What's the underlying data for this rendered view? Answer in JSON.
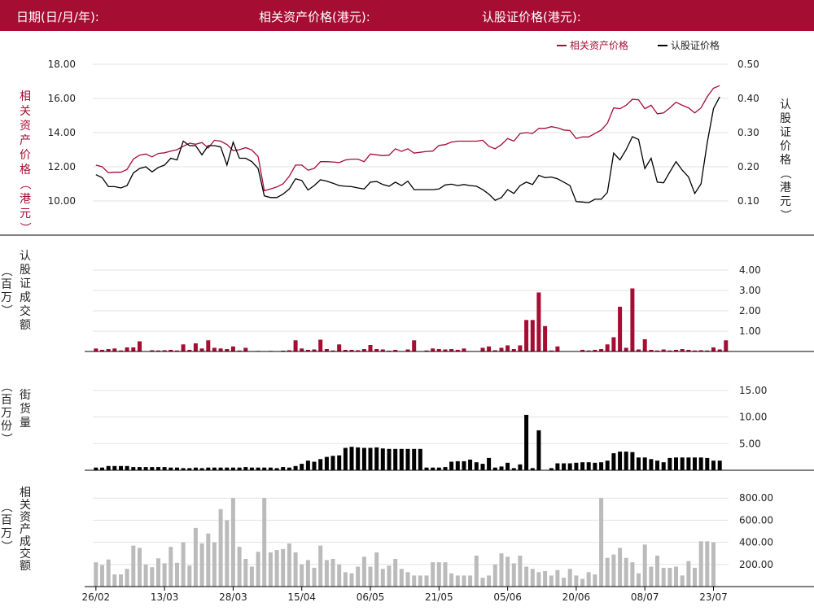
{
  "header": {
    "date_label": "日期(日/月/年):",
    "date_value": "",
    "asset_price_label": "相关资产价格(港元):",
    "asset_price_value": "",
    "warrant_price_label": "认股证价格(港元):",
    "warrant_price_value": ""
  },
  "colors": {
    "header_bg": "#a50d33",
    "asset": "#a50d33",
    "warrant": "#000000",
    "asset_turnover_bars": "#bbbbbb"
  },
  "legend": {
    "asset": "相关资产价格",
    "warrant": "认股证价格"
  },
  "x_tick_labels": [
    "26/02",
    "13/03",
    "28/03",
    "15/04",
    "06/05",
    "21/05",
    "05/06",
    "20/06",
    "08/07",
    "23/07"
  ],
  "chart_data": [
    {
      "type": "line",
      "title": "",
      "left_axis_label": "相关资产价格（港元）",
      "right_axis_label": "认股证价格（港元）",
      "left_ticks": [
        "10.00",
        "12.00",
        "14.00",
        "16.00",
        "18.00"
      ],
      "right_ticks": [
        "0.10",
        "0.20",
        "0.30",
        "0.40",
        "0.50"
      ],
      "ylim_left": [
        10,
        18
      ],
      "ylim_right": [
        0.1,
        0.5
      ],
      "x_count": 101,
      "grid": true,
      "legend_position": "top-right",
      "series": [
        {
          "name": "相关资产价格",
          "axis": "left",
          "values": [
            12.1,
            12.0,
            11.65,
            11.68,
            11.68,
            11.85,
            12.45,
            12.68,
            12.75,
            12.58,
            12.78,
            12.82,
            12.92,
            13.0,
            13.2,
            13.38,
            13.32,
            13.42,
            13.1,
            13.55,
            13.5,
            13.3,
            12.95,
            13.0,
            13.12,
            12.98,
            12.6,
            10.6,
            10.7,
            10.82,
            11.0,
            11.45,
            12.1,
            12.1,
            11.8,
            11.9,
            12.3,
            12.3,
            12.28,
            12.25,
            12.4,
            12.45,
            12.45,
            12.3,
            12.75,
            12.7,
            12.65,
            12.68,
            13.05,
            12.9,
            13.05,
            12.8,
            12.85,
            12.9,
            12.92,
            13.25,
            13.3,
            13.45,
            13.5,
            13.5,
            13.5,
            13.5,
            13.55,
            13.2,
            13.05,
            13.3,
            13.65,
            13.5,
            13.95,
            14.0,
            13.95,
            14.25,
            14.25,
            14.35,
            14.28,
            14.15,
            14.12,
            13.65,
            13.75,
            13.75,
            13.95,
            14.15,
            14.55,
            15.45,
            15.4,
            15.6,
            15.95,
            15.92,
            15.4,
            15.6,
            15.1,
            15.15,
            15.45,
            15.78,
            15.6,
            15.45,
            15.15,
            15.45,
            16.1,
            16.6,
            16.75
          ]
        },
        {
          "name": "认股证价格",
          "axis": "right",
          "values": [
            0.177,
            0.168,
            0.142,
            0.142,
            0.138,
            0.145,
            0.182,
            0.195,
            0.2,
            0.185,
            0.198,
            0.205,
            0.225,
            0.22,
            0.275,
            0.262,
            0.262,
            0.235,
            0.262,
            0.262,
            0.258,
            0.205,
            0.272,
            0.225,
            0.225,
            0.215,
            0.195,
            0.115,
            0.11,
            0.11,
            0.12,
            0.135,
            0.165,
            0.16,
            0.132,
            0.145,
            0.162,
            0.158,
            0.152,
            0.145,
            0.143,
            0.142,
            0.138,
            0.135,
            0.155,
            0.157,
            0.148,
            0.143,
            0.155,
            0.145,
            0.158,
            0.133,
            0.133,
            0.133,
            0.133,
            0.135,
            0.147,
            0.149,
            0.145,
            0.148,
            0.145,
            0.143,
            0.133,
            0.12,
            0.102,
            0.11,
            0.133,
            0.122,
            0.145,
            0.155,
            0.148,
            0.175,
            0.168,
            0.17,
            0.165,
            0.155,
            0.145,
            0.098,
            0.097,
            0.095,
            0.105,
            0.105,
            0.125,
            0.24,
            0.22,
            0.25,
            0.288,
            0.28,
            0.195,
            0.225,
            0.155,
            0.153,
            0.185,
            0.215,
            0.19,
            0.17,
            0.122,
            0.15,
            0.27,
            0.37,
            0.405
          ]
        }
      ]
    },
    {
      "type": "bar",
      "title": "",
      "y_label": "认股证成交额（百万）",
      "y_ticks": [
        "1.00",
        "2.00",
        "3.00",
        "4.00"
      ],
      "ylim": [
        0,
        4.4
      ],
      "color": "#a50d33",
      "values": [
        0.15,
        0.08,
        0.12,
        0.15,
        0.05,
        0.2,
        0.2,
        0.5,
        0,
        0.06,
        0.05,
        0.06,
        0.08,
        0.05,
        0.35,
        0.08,
        0.4,
        0.15,
        0.55,
        0.18,
        0.15,
        0.12,
        0.25,
        0.05,
        0.18,
        0,
        0.03,
        0,
        0.03,
        0.02,
        0.04,
        0.06,
        0.55,
        0.15,
        0.08,
        0.1,
        0.58,
        0.12,
        0.05,
        0.35,
        0.08,
        0.08,
        0.06,
        0.12,
        0.32,
        0.12,
        0.1,
        0.04,
        0.08,
        0.02,
        0.1,
        0.55,
        0,
        0.05,
        0.15,
        0.12,
        0.1,
        0.12,
        0.08,
        0.15,
        0.02,
        0.02,
        0.18,
        0.25,
        0.06,
        0.18,
        0.3,
        0.12,
        0.3,
        1.55,
        1.55,
        2.9,
        1.25,
        0.05,
        0.25,
        0,
        0.02,
        0.02,
        0.08,
        0.05,
        0.08,
        0.12,
        0.35,
        0.7,
        2.2,
        0.18,
        3.1,
        0.1,
        0.6,
        0.08,
        0.05,
        0.1,
        0.05,
        0.08,
        0.12,
        0.08,
        0.05,
        0.06,
        0.05,
        0.2,
        0.1,
        0.55
      ]
    },
    {
      "type": "bar",
      "title": "",
      "y_label": "街货量（百万份）",
      "y_ticks": [
        "5.00",
        "10.00",
        "15.00"
      ],
      "ylim": [
        0,
        16.5
      ],
      "color": "#000000",
      "values": [
        0.5,
        0.5,
        0.8,
        0.8,
        0.8,
        0.8,
        0.6,
        0.6,
        0.6,
        0.6,
        0.6,
        0.6,
        0.5,
        0.5,
        0.4,
        0.4,
        0.5,
        0.4,
        0.5,
        0.5,
        0.5,
        0.5,
        0.5,
        0.5,
        0.6,
        0.5,
        0.5,
        0.5,
        0.5,
        0.4,
        0.6,
        0.5,
        0.8,
        1.2,
        1.8,
        1.6,
        2.1,
        2.5,
        2.7,
        2.8,
        4.2,
        4.4,
        4.3,
        4.2,
        4.2,
        4.3,
        4.1,
        4.0,
        4.0,
        4.0,
        4.0,
        4.0,
        4.0,
        0.5,
        0.5,
        0.5,
        0.6,
        1.6,
        1.7,
        1.7,
        2.0,
        1.5,
        1.2,
        2.3,
        0.5,
        0.7,
        1.4,
        0.4,
        1.1,
        10.4,
        0.4,
        7.5,
        0,
        0.4,
        1.3,
        1.3,
        1.3,
        1.4,
        1.5,
        1.5,
        1.4,
        1.5,
        1.8,
        3.2,
        3.5,
        3.5,
        3.4,
        2.4,
        2.4,
        2.1,
        1.8,
        1.5,
        2.3,
        2.4,
        2.4,
        2.4,
        2.4,
        2.4,
        2.3,
        1.8,
        1.8
      ]
    },
    {
      "type": "bar",
      "title": "",
      "y_label": "相关资产成交额（百万）",
      "y_ticks": [
        "200.00",
        "400.00",
        "600.00",
        "800.00"
      ],
      "ylim": [
        0,
        890
      ],
      "color": "#bbbbbb",
      "values": [
        220,
        195,
        245,
        110,
        110,
        160,
        370,
        350,
        200,
        175,
        255,
        210,
        360,
        215,
        400,
        190,
        530,
        390,
        480,
        400,
        700,
        600,
        800,
        360,
        250,
        180,
        315,
        800,
        310,
        330,
        340,
        390,
        310,
        200,
        240,
        170,
        370,
        240,
        250,
        200,
        130,
        120,
        180,
        270,
        180,
        310,
        160,
        190,
        250,
        160,
        130,
        100,
        100,
        100,
        220,
        220,
        220,
        120,
        100,
        100,
        100,
        280,
        80,
        100,
        200,
        300,
        270,
        210,
        280,
        180,
        160,
        130,
        140,
        100,
        150,
        80,
        160,
        100,
        70,
        130,
        110,
        800,
        260,
        290,
        350,
        260,
        220,
        120,
        380,
        180,
        280,
        170,
        170,
        180,
        100,
        230,
        170,
        410,
        410,
        400
      ]
    }
  ]
}
